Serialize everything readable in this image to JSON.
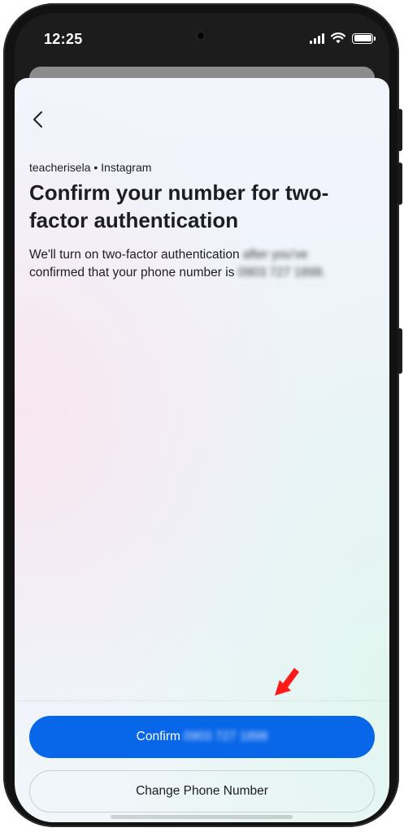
{
  "status_bar": {
    "time": "12:25"
  },
  "header": {
    "back_icon": "chevron-left-icon"
  },
  "content": {
    "account_line": "teacherisela • Instagram",
    "title": "Confirm your number for two-factor authentication",
    "description_visible": "We'll turn on two-factor authentication",
    "description_blurred_1": "after you've",
    "description_line2": "confirmed that your phone number is",
    "description_blurred_2": "0903 727 1898."
  },
  "actions": {
    "confirm_label": "Confirm",
    "confirm_number_blurred": "0903 727 1898",
    "change_label": "Change Phone Number"
  },
  "colors": {
    "primary_button": "#0866e8",
    "annotation_arrow": "#ff1a1a",
    "text": "#1c1e21"
  }
}
